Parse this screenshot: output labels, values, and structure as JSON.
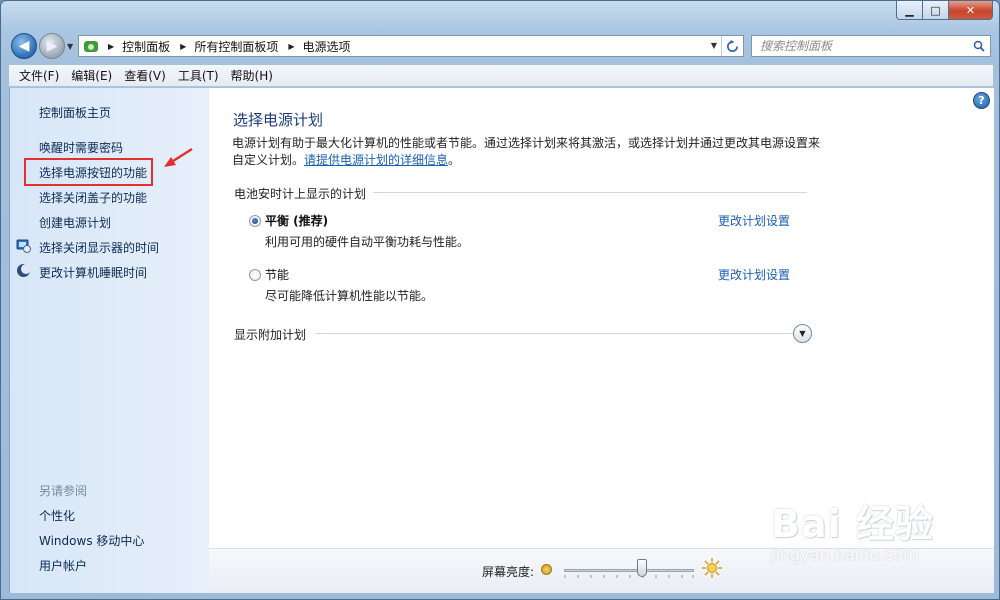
{
  "window": {
    "controls": {
      "minimize": "▁",
      "maximize": "□",
      "close": "✕"
    }
  },
  "address_bar": {
    "crumbs": [
      "控制面板",
      "所有控制面板项",
      "电源选项"
    ]
  },
  "search": {
    "placeholder": "搜索控制面板"
  },
  "menu": [
    "文件(F)",
    "编辑(E)",
    "查看(V)",
    "工具(T)",
    "帮助(H)"
  ],
  "sidebar": {
    "home": "控制面板主页",
    "links": [
      "唤醒时需要密码",
      "选择电源按钮的功能",
      "选择关闭盖子的功能",
      "创建电源计划",
      "选择关闭显示器的时间",
      "更改计算机睡眠时间"
    ],
    "see_also_header": "另请参阅",
    "see_also": [
      "个性化",
      "Windows 移动中心",
      "用户帐户"
    ]
  },
  "main": {
    "title": "选择电源计划",
    "intro": "电源计划有助于最大化计算机的性能或者节能。通过选择计划来将其激活，或选择计划并通过更改其电源设置来自定义计划。",
    "intro_link": "请提供电源计划的详细信息",
    "intro_end": "。",
    "group_label": "电池安时计上显示的计划",
    "plans": [
      {
        "name": "平衡 (推荐)",
        "desc": "利用可用的硬件自动平衡功耗与性能。",
        "link": "更改计划设置",
        "selected": true
      },
      {
        "name": "节能",
        "desc": "尽可能降低计算机性能以节能。",
        "link": "更改计划设置",
        "selected": false
      }
    ],
    "extra_label": "显示附加计划"
  },
  "brightness": {
    "label": "屏幕亮度:",
    "value_fraction": 0.6
  },
  "watermark": {
    "main": "Bai 经验",
    "sub": "jingyan.baidu.com"
  },
  "colors": {
    "annotation_red": "#e03030",
    "link_blue": "#1a5fb4",
    "title_blue": "#1c3e7a"
  }
}
